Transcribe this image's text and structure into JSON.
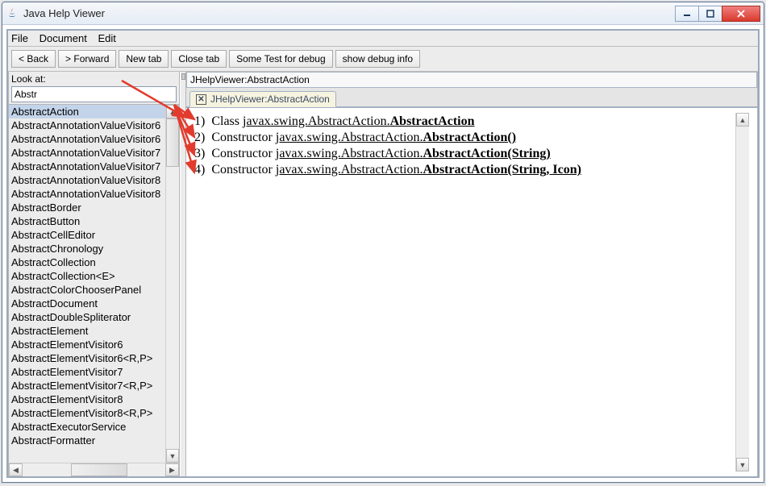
{
  "window": {
    "title": "Java Help Viewer"
  },
  "menu": {
    "file": "File",
    "document": "Document",
    "edit": "Edit"
  },
  "toolbar": {
    "back": "< Back",
    "forward": "> Forward",
    "newtab": "New tab",
    "closetab": "Close tab",
    "sometest": "Some Test for debug",
    "showdebug": "show debug info"
  },
  "search": {
    "label": "Look at:",
    "value": "Abstr"
  },
  "list": {
    "items": [
      "AbstractAction",
      "AbstractAnnotationValueVisitor6",
      "AbstractAnnotationValueVisitor6",
      "AbstractAnnotationValueVisitor7",
      "AbstractAnnotationValueVisitor7",
      "AbstractAnnotationValueVisitor8",
      "AbstractAnnotationValueVisitor8",
      "AbstractBorder",
      "AbstractButton",
      "AbstractCellEditor",
      "AbstractChronology",
      "AbstractCollection",
      "AbstractCollection<E>",
      "AbstractColorChooserPanel",
      "AbstractDocument",
      "AbstractDoubleSpliterator",
      "AbstractElement",
      "AbstractElementVisitor6",
      "AbstractElementVisitor6<R,P>",
      "AbstractElementVisitor7",
      "AbstractElementVisitor7<R,P>",
      "AbstractElementVisitor8",
      "AbstractElementVisitor8<R,P>",
      "AbstractExecutorService",
      "AbstractFormatter"
    ],
    "selected_index": 0
  },
  "path": "JHelpViewer:AbstractAction",
  "tab": {
    "label": "JHelpViewer:AbstractAction"
  },
  "results": [
    {
      "n": "1)",
      "kind": "Class",
      "pkg": "javax.swing.AbstractAction.",
      "sig": "AbstractAction"
    },
    {
      "n": "2)",
      "kind": "Constructor",
      "pkg": "javax.swing.AbstractAction.",
      "sig": "AbstractAction()"
    },
    {
      "n": "3)",
      "kind": "Constructor",
      "pkg": "javax.swing.AbstractAction.",
      "sig": "AbstractAction(String)"
    },
    {
      "n": "4)",
      "kind": "Constructor",
      "pkg": "javax.swing.AbstractAction.",
      "sig": "AbstractAction(String, Icon)"
    }
  ]
}
